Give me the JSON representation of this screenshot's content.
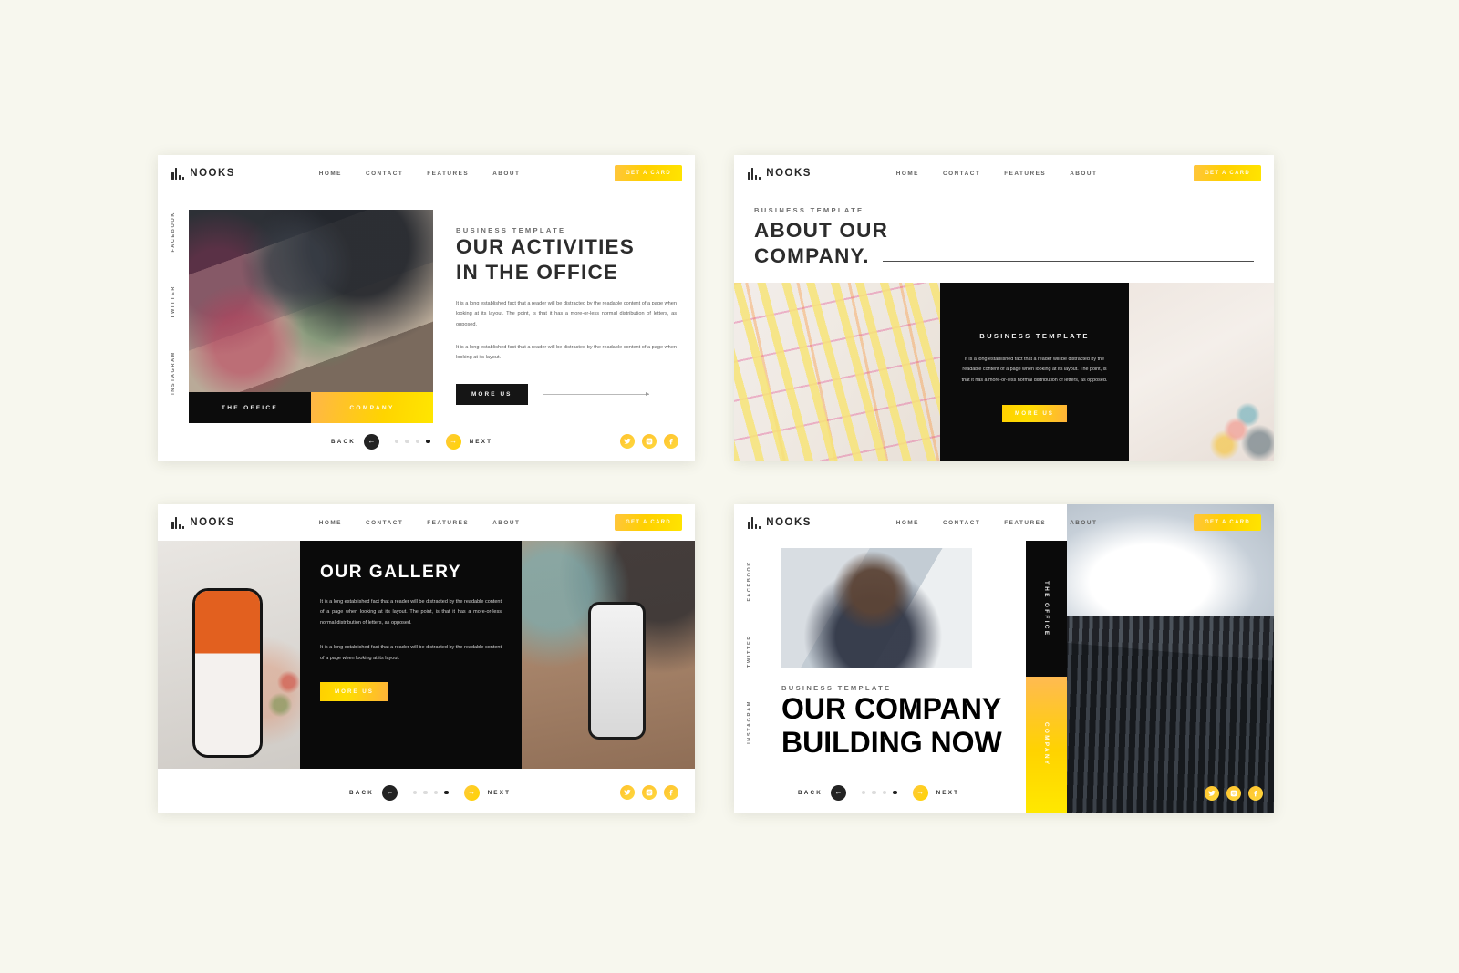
{
  "brand": {
    "name": "NOOKS",
    "logo_icon": "bar-chart-logo-icon"
  },
  "nav": {
    "links": [
      "HOME",
      "CONTACT",
      "FEATURES",
      "ABOUT"
    ],
    "cta_label": "GET A CARD"
  },
  "social_rail": [
    "FACEBOOK",
    "TWITTER",
    "INSTAGRAM"
  ],
  "social_icons": [
    "twitter-icon",
    "instagram-icon",
    "facebook-icon"
  ],
  "pager": {
    "back_label": "BACK",
    "next_label": "NEXT",
    "dots_total": 4,
    "dots_active_index": 3,
    "back_arrow": "arrow-left-icon",
    "next_arrow": "arrow-right-icon"
  },
  "colors": {
    "page_background": "#f7f7ee",
    "accent_yellow": "#ffd400",
    "accent_orange": "#ffb648",
    "dark": "#0b0b0b",
    "text": "#2c2c2c",
    "muted_text": "#5a5a5a"
  },
  "paragraphs": {
    "long": "It is a long established fact that a reader will be distracted by the readable content of a page when looking at its layout. The point, is that it has a more-or-less normal distribution of letters, as opposed.",
    "short": "It is a long established fact that a reader will be distracted by the readable content of a page when looking at its layout."
  },
  "slides": [
    {
      "id": "slide-1",
      "kicker": "BUSINESS TEMPLATE",
      "headline_line1": "OUR ACTIVITIES",
      "headline_line2": "IN THE OFFICE",
      "button_label": "MORE US",
      "photo_caption_left": "THE OFFICE",
      "photo_caption_right": "COMPANY",
      "photo_alt": "team working around an office table"
    },
    {
      "id": "slide-2",
      "kicker": "BUSINESS TEMPLATE",
      "headline_line1": "ABOUT OUR",
      "headline_line2": "COMPANY.",
      "card_kicker": "BUSINESS TEMPLATE",
      "card_button_label": "MORE US",
      "photo_left_alt": "sticky note brainstorming board",
      "photo_right_alt": "planner notebook with colorful stickers"
    },
    {
      "id": "slide-3",
      "headline": "OUR GALLERY",
      "button_label": "MORE US",
      "photo_left_alt": "hand holding smartphone with orange app",
      "photo_right_alt": "hands using phone at a wooden desk"
    },
    {
      "id": "slide-4",
      "kicker": "BUSINESS TEMPLATE",
      "headline_line1": "OUR COMPANY",
      "headline_line2": "BUILDING NOW",
      "bar_label_top": "THE OFFICE",
      "bar_label_bottom": "COMPANY",
      "photo_alt": "support agent wearing a headset",
      "hero_alt": "modern glass office tower from below"
    }
  ]
}
